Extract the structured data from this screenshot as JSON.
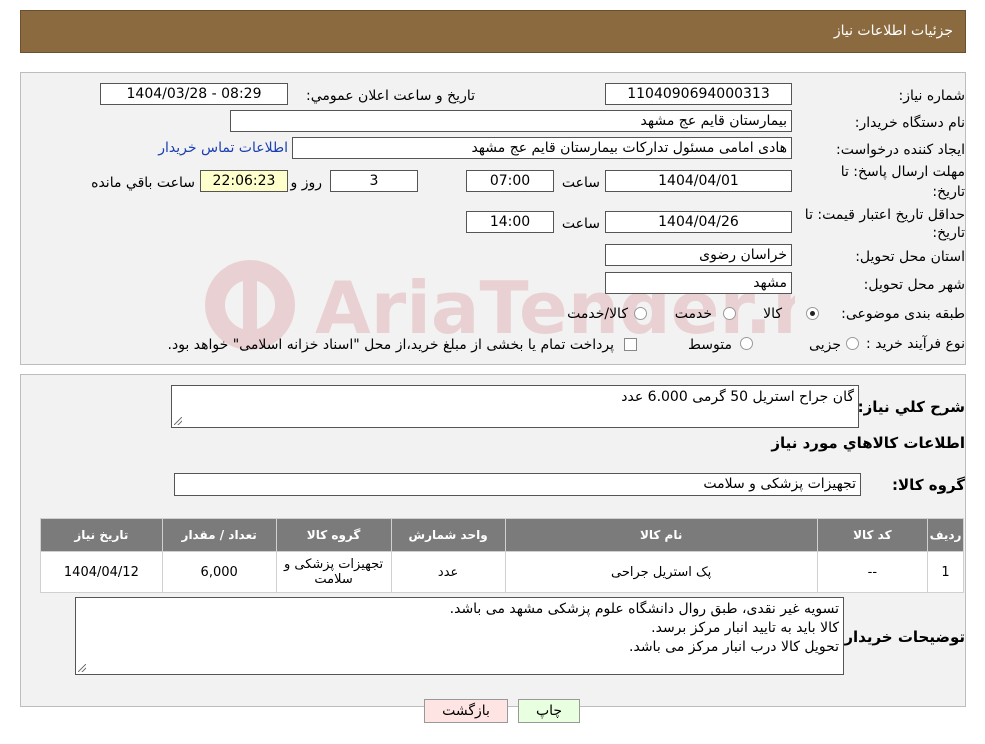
{
  "header": {
    "title": "جزئيات اطلاعات نياز"
  },
  "form": {
    "need_number_label": "شماره نياز:",
    "need_number": "1104090694000313",
    "announce_label": "تاريخ و ساعت اعلان عمومي:",
    "announce_value": "1404/03/28 - 08:29",
    "buyer_org_label": "نام دستگاه خريدار:",
    "buyer_org": "بیمارستان قایم  عج  مشهد",
    "creator_label": "ايجاد کننده درخواست:",
    "creator": "هادی امامی مسئول تدارکات بیمارستان قایم  عج  مشهد",
    "contact_link": "اطلاعات تماس خريدار",
    "deadline_label_1": "مهلت ارسال پاسخ: تا",
    "deadline_label_2": "تاريخ:",
    "deadline_date": "1404/04/01",
    "time_label": "ساعت",
    "deadline_time": "07:00",
    "days_value": "3",
    "days_label": "روز و",
    "remaining_time": "22:06:23",
    "remaining_label": "ساعت باقي مانده",
    "validity_label_1": "حداقل تاريخ اعتبار قيمت: تا",
    "validity_label_2": "تاريخ:",
    "validity_date": "1404/04/26",
    "validity_time": "14:00",
    "province_label": "استان محل تحويل:",
    "province": "خراسان رضوی",
    "city_label": "شهر محل تحويل:",
    "city": "مشهد",
    "category_label": "طبقه بندی موضوعی:",
    "category_options": [
      "کالا",
      "خدمت",
      "کالا/خدمت"
    ],
    "purchase_type_label": "نوع فرآيند خريد :",
    "purchase_options": [
      "جزیی",
      "متوسط"
    ],
    "payment_note": "پرداخت تمام يا بخشی از مبلغ خريد،از محل \"اسناد خزانه اسلامی\" خواهد بود."
  },
  "description": {
    "label": "شرح کلي نياز:",
    "value": "گان جراح استریل 50 گرمی 6.000 عدد"
  },
  "goods": {
    "section_title": "اطلاعات کالاهاي مورد نياز",
    "group_label": "گروه کالا:",
    "group_value": "تجهیزات پزشکی و سلامت"
  },
  "table": {
    "headers": [
      "رديف",
      "کد کالا",
      "نام کالا",
      "واحد شمارش",
      "گروه کالا",
      "تعداد / مقدار",
      "تاريخ نياز"
    ],
    "rows": [
      [
        "1",
        "--",
        "پک استریل جراحی",
        "عدد",
        "تجهیزات پزشکی و سلامت",
        "6,000",
        "1404/04/12"
      ]
    ]
  },
  "notes": {
    "label": "توضيحات خريدار:",
    "lines": [
      "تسویه غیر نقدی، طبق روال دانشگاه علوم پزشکی مشهد می باشد.",
      "کالا باید به تایید انبار مرکز برسد.",
      "تحویل کالا درب انبار مرکز می باشد."
    ]
  },
  "buttons": {
    "print": "چاپ",
    "back": "بازگشت"
  },
  "watermark": {
    "text": "AriaTender.neT"
  },
  "colors": {
    "header": "#8b6a3f",
    "table_header": "#7b7b7b",
    "back_button": "#ffe4e4",
    "print_button": "#e8ffe0",
    "time_field": "#ffffcc",
    "link": "#1a3fb0"
  }
}
